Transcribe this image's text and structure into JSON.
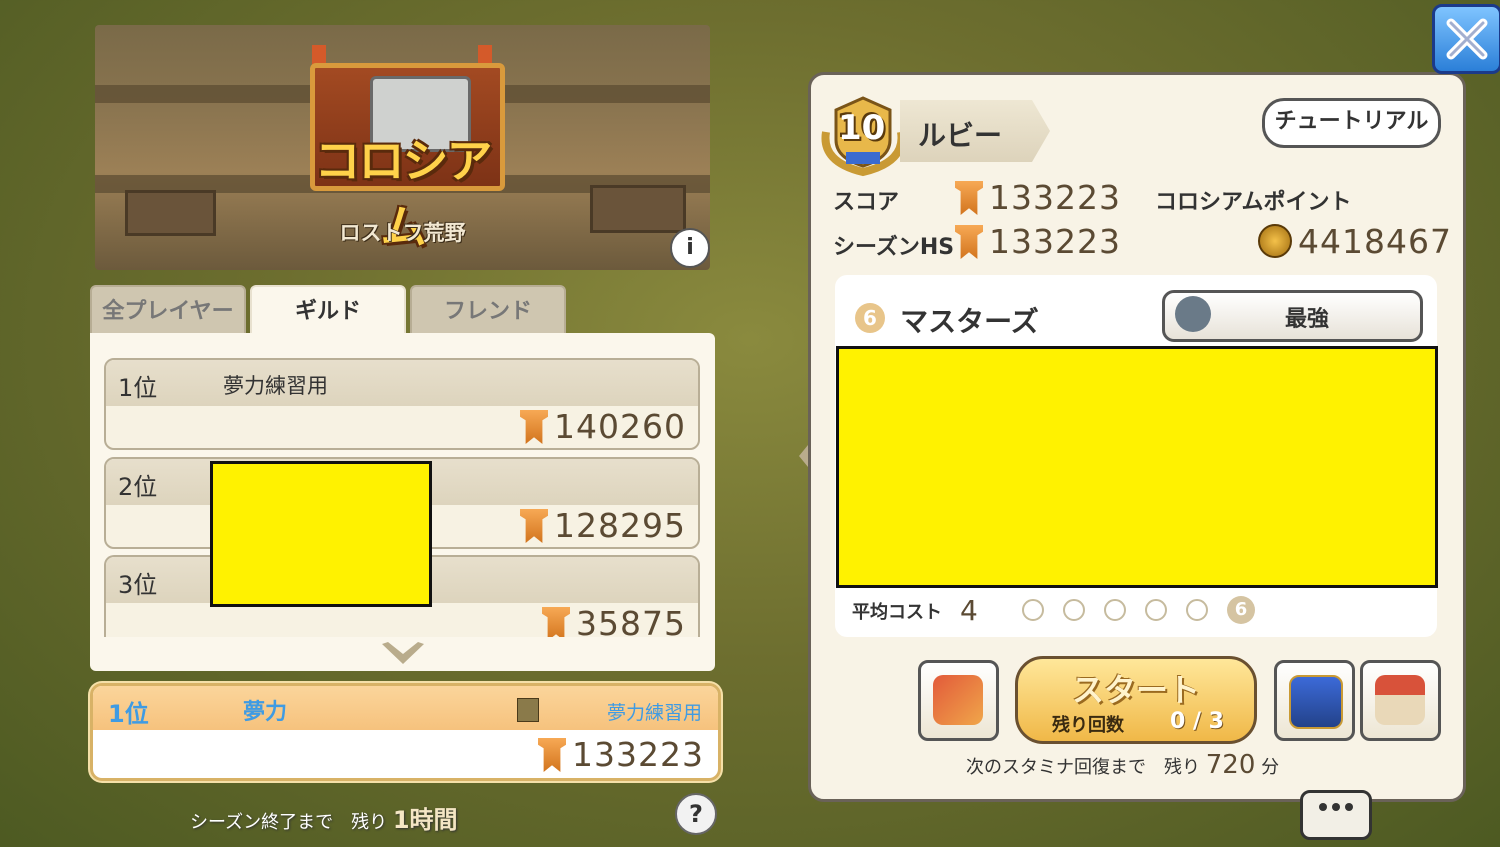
{
  "banner": {
    "logo_text": "コロシアム",
    "area_name": "ロストフ荒野",
    "info_icon": "i"
  },
  "tabs": [
    {
      "label": "全プレイヤー",
      "active": false
    },
    {
      "label": "ギルド",
      "active": true
    },
    {
      "label": "フレンド",
      "active": false
    }
  ],
  "ranking": [
    {
      "pos": "1位",
      "name": "夢力練習用",
      "score": "140260"
    },
    {
      "pos": "2位",
      "name": "",
      "score": "128295"
    },
    {
      "pos": "3位",
      "name": "",
      "score": "35875"
    }
  ],
  "my_rank": {
    "pos": "1位",
    "name": "夢力",
    "guild": "夢力練習用",
    "score": "133223"
  },
  "season": {
    "prefix": "シーズン終了まで　残り",
    "time": "1時間"
  },
  "help_icon": "?",
  "close_icon": "close-icon",
  "right": {
    "rank_number": "10",
    "rank_name": "ルビー",
    "tutorial_label": "チュートリアル",
    "score_label": "スコア",
    "score_value": "133223",
    "season_hs_label": "シーズンHS",
    "season_hs_value": "133223",
    "colosseum_points_label": "コロシアムポイント",
    "colosseum_points_value": "4418467",
    "team_number": "6",
    "team_name": "マスターズ",
    "strongest_label": "最強",
    "avg_cost_label": "平均コスト",
    "avg_cost_value": "4",
    "selected_slot": "6",
    "start_label": "スタート",
    "remaining_label": "残り回数",
    "remaining_value": "0 / 3",
    "stamina_label": "次のスタミナ回復まで　残り",
    "stamina_value": "720",
    "stamina_unit": "分"
  },
  "colors": {
    "accent_blue": "#3f9be3",
    "score_brown": "#5b4a33",
    "redaction": "#fff200"
  }
}
